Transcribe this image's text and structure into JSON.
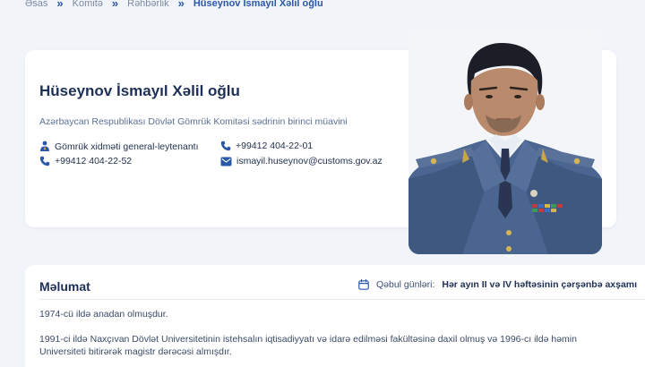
{
  "breadcrumb": {
    "items": [
      "Əsas",
      "Komitə",
      "Rəhbərlik"
    ],
    "current": "Hüseynov İsmayıl Xəlil oğlu"
  },
  "profile": {
    "name": "Hüseynov İsmayıl Xəlil oğlu",
    "position": "Azərbaycan Respublikası Dövlət Gömrük Komitəsi sədrinin birinci müavini",
    "rank": "Gömrük xidməti general-leytenantı",
    "phone_1": "+99412 404-22-01",
    "phone_2": "+99412 404-22-52",
    "email": "ismayil.huseynov@customs.gov.az"
  },
  "info": {
    "title": "Məlumat",
    "reception_label": "Qəbul günləri:",
    "reception_days": "Hər ayın II və IV həftəsinin çərşənbə axşamı",
    "paragraphs": [
      "1974-cü ildə anadan olmuşdur.",
      "1991-ci ildə Naxçıvan Dövlət Universitetinin istehsalın iqtisadiyyatı və idarə edilməsi fakültəsinə daxil olmuş və  1996-cı ildə həmin",
      "Universiteti bitirərək magistr dərəcəsi almışdır."
    ]
  },
  "colors": {
    "accent": "#2a58a8",
    "uniform": "#4a6590",
    "background": "#f1f4f9"
  }
}
